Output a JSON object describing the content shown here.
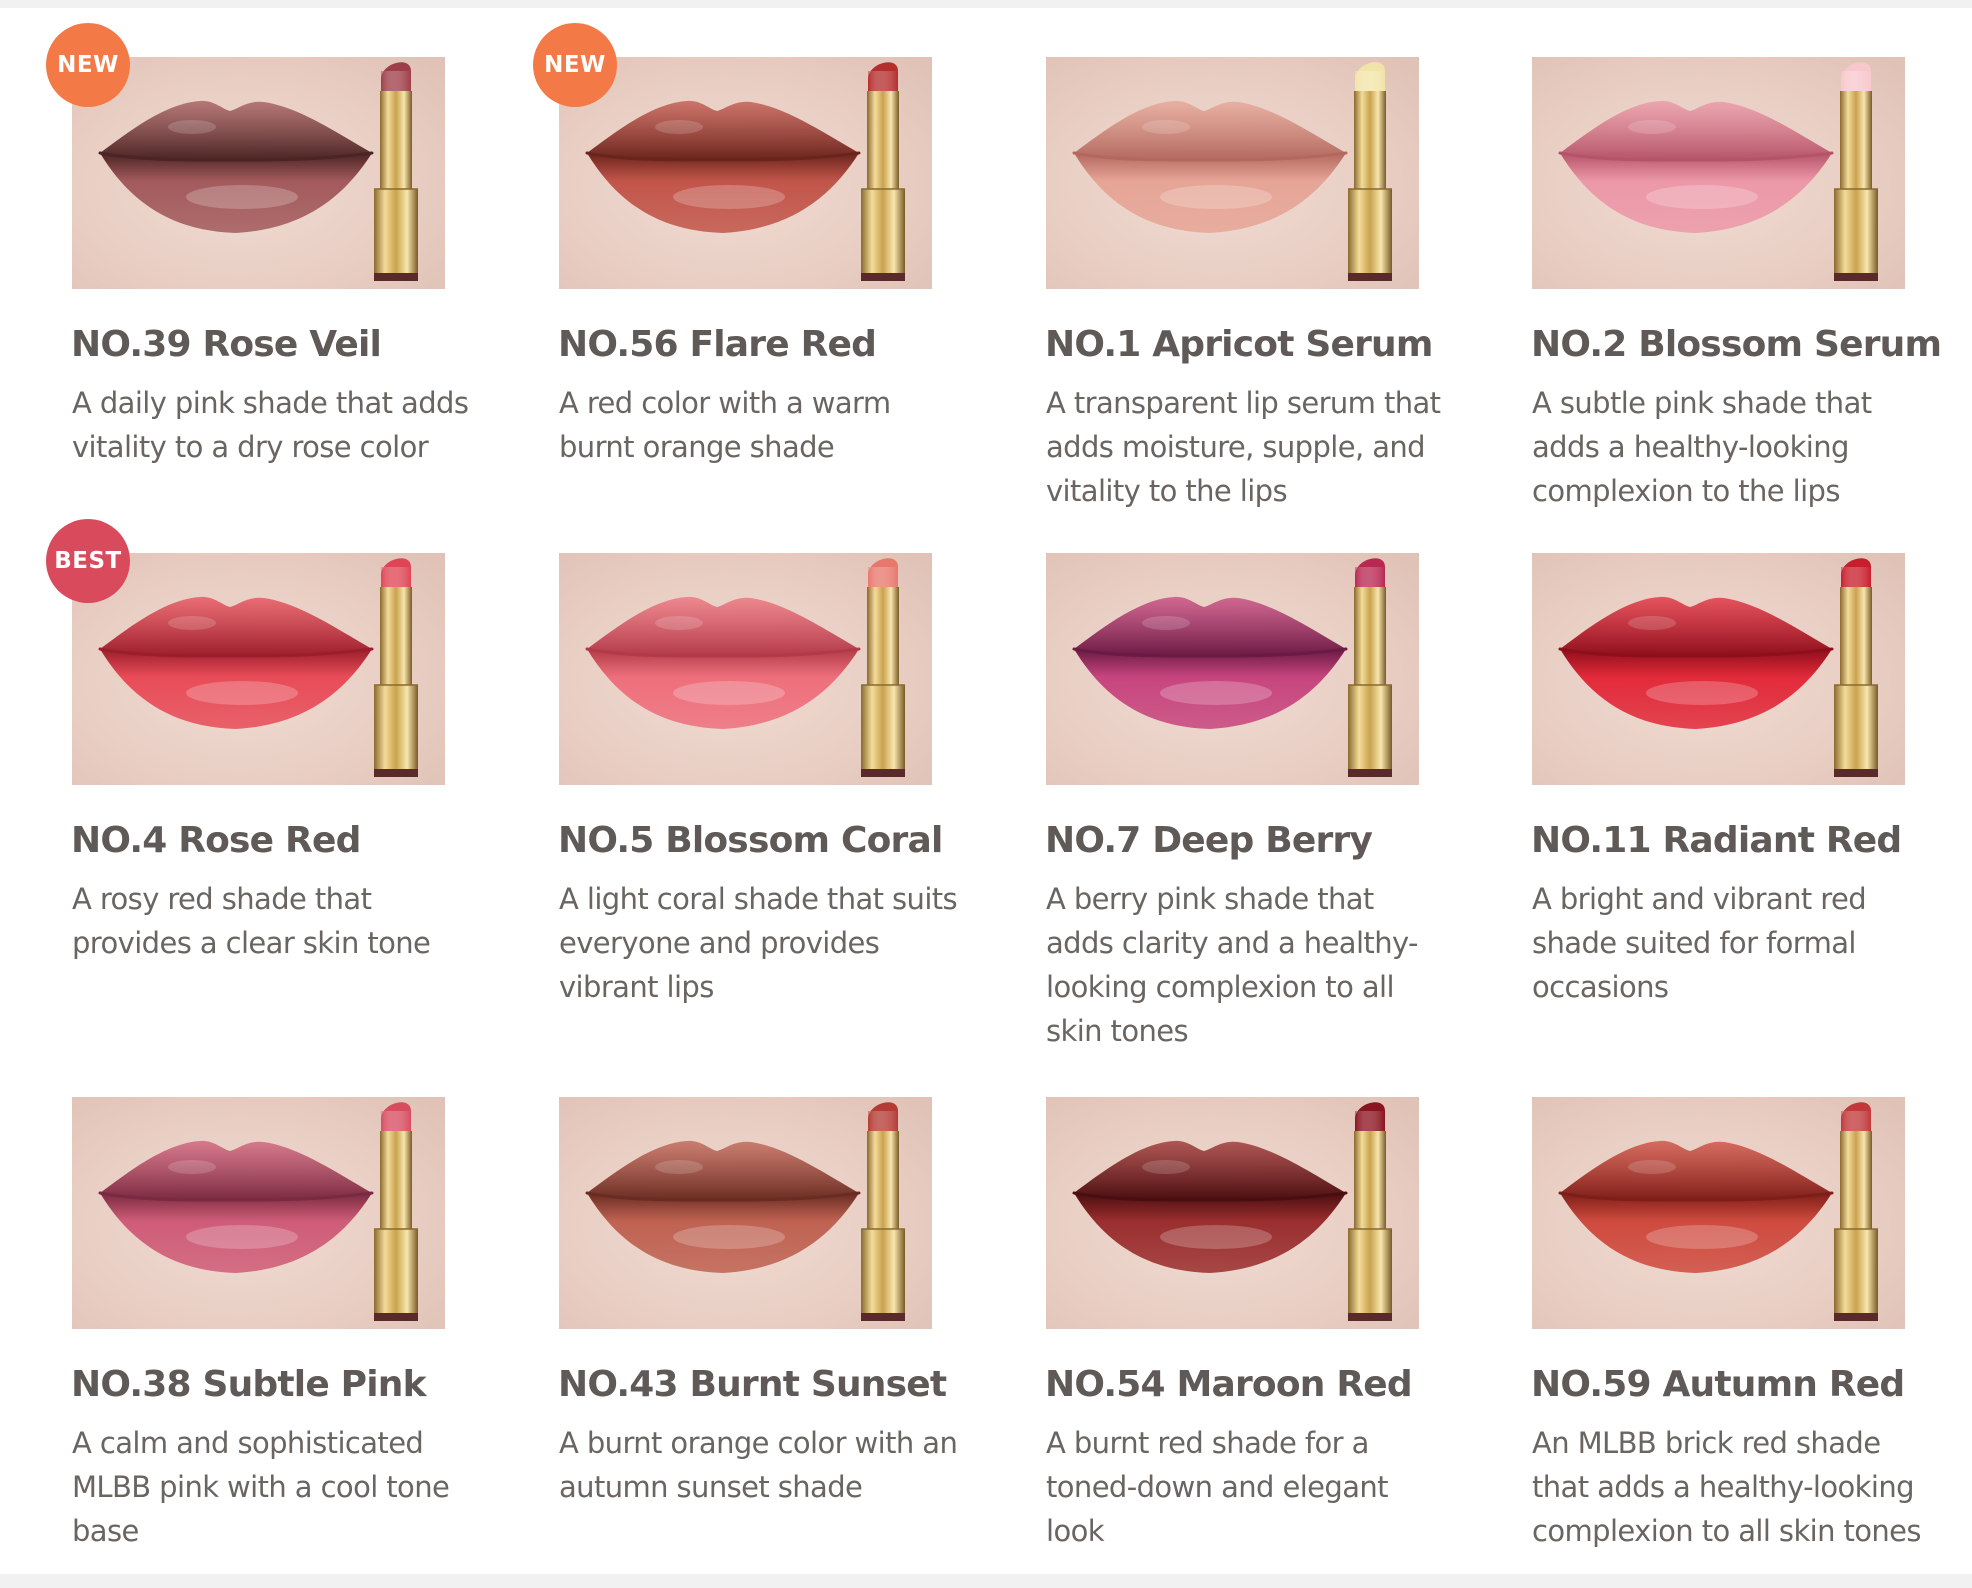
{
  "badge_colors": {
    "NEW": "#f37a47",
    "BEST": "#d84a5c"
  },
  "shades": [
    {
      "name": "NO.39 Rose Veil",
      "desc": "A daily pink shade that adds vitality to a dry rose color",
      "badge": "NEW",
      "lip_color": "#a35a5c",
      "lip_dark": "#4b2424",
      "stick_color": "#9e3e48"
    },
    {
      "name": "NO.56 Flare Red",
      "desc": "A red color with a warm burnt orange shade",
      "badge": "NEW",
      "lip_color": "#c2554a",
      "lip_dark": "#6a241c",
      "stick_color": "#b52e2e"
    },
    {
      "name": "NO.1 Apricot Serum",
      "desc": "A transparent lip serum that adds moisture, supple, and vitality to the lips",
      "badge": "",
      "lip_color": "#e6a596",
      "lip_dark": "#b3685e",
      "stick_color": "#f2e4a8"
    },
    {
      "name": "NO.2 Blossom Serum",
      "desc": "A subtle pink shade that adds a healthy-looking complexion to the lips",
      "badge": "",
      "lip_color": "#ec98a8",
      "lip_dark": "#b55468",
      "stick_color": "#f7c7cc"
    },
    {
      "name": "NO.4 Rose Red",
      "desc": "A rosy red shade that provides a clear skin tone",
      "badge": "BEST",
      "lip_color": "#e84c58",
      "lip_dark": "#9c1e2c",
      "stick_color": "#e04555"
    },
    {
      "name": "NO.5 Blossom Coral",
      "desc": "A light coral shade that suits everyone and provides vibrant lips",
      "badge": "",
      "lip_color": "#ee6f7c",
      "lip_dark": "#b23a48",
      "stick_color": "#e8776c"
    },
    {
      "name": "NO.7 Deep Berry",
      "desc": "A berry pink shade that adds clarity and a healthy-looking complexion to all skin tones",
      "badge": "",
      "lip_color": "#c7457e",
      "lip_dark": "#6a1a44",
      "stick_color": "#b82852"
    },
    {
      "name": "NO.11 Radiant Red",
      "desc": "A bright and vibrant red shade suited for formal occasions",
      "badge": "",
      "lip_color": "#e22a3a",
      "lip_dark": "#8e0e1c",
      "stick_color": "#c81e2c"
    },
    {
      "name": "NO.38 Subtle Pink",
      "desc": "A calm and sophisticated MLBB pink with a cool tone base",
      "badge": "",
      "lip_color": "#cf5c78",
      "lip_dark": "#7a2a40",
      "stick_color": "#d84c60"
    },
    {
      "name": "NO.43 Burnt Sunset",
      "desc": "A burnt orange color with an autumn sunset shade",
      "badge": "",
      "lip_color": "#bf6252",
      "lip_dark": "#6a2c22",
      "stick_color": "#b43a34"
    },
    {
      "name": "NO.54 Maroon Red",
      "desc": "A burnt red shade for a toned-down and elegant look",
      "badge": "",
      "lip_color": "#9a2e2e",
      "lip_dark": "#4a0e10",
      "stick_color": "#8a1420"
    },
    {
      "name": "NO.59 Autumn Red",
      "desc": "An MLBB brick red shade that adds a healthy-looking complexion to all skin tones",
      "badge": "",
      "lip_color": "#cf4a3e",
      "lip_dark": "#7e1e18",
      "stick_color": "#c0383a"
    }
  ]
}
